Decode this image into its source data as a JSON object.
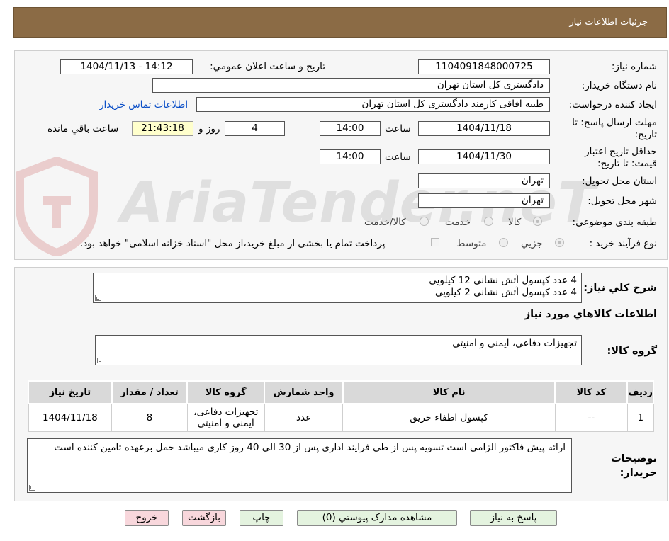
{
  "header": {
    "title": "جزئیات اطلاعات نیاز"
  },
  "need_number": {
    "label": "شماره نیاز:",
    "value": "1104091848000725"
  },
  "announce_datetime": {
    "label": "تاریخ و ساعت اعلان عمومي:",
    "value": "1404/11/13 - 14:12"
  },
  "buyer_org": {
    "label": "نام دستگاه خريدار:",
    "value": "دادگستری کل استان تهران"
  },
  "requester": {
    "label": "ايجاد کننده درخواست:",
    "value": "طیبه افاقی کارمند دادگستری کل استان تهران",
    "contact_link": "اطلاعات تماس خريدار"
  },
  "reply_deadline": {
    "label": "مهلت ارسال پاسخ: تا تاریخ:",
    "date": "1404/11/18",
    "time_label": "ساعت",
    "time": "14:00",
    "days": "4",
    "days_label": "روز و",
    "remaining": "21:43:18",
    "remaining_label": "ساعت باقي مانده"
  },
  "price_validity": {
    "label": "حداقل تاريخ اعتبار قيمت: تا تاريخ:",
    "date": "1404/11/30",
    "time_label": "ساعت",
    "time": "14:00"
  },
  "delivery_province": {
    "label": "استان محل تحويل:",
    "value": "تهران"
  },
  "delivery_city": {
    "label": "شهر محل تحويل:",
    "value": "تهران"
  },
  "category": {
    "label": "طبقه بندی موضوعی:",
    "options": [
      "کالا",
      "خدمت",
      "کالا/خدمت"
    ]
  },
  "purchase_process": {
    "label": "نوع فرآيند خريد :",
    "options": [
      "جزيي",
      "متوسط"
    ],
    "payment_note": "پرداخت تمام يا بخشی از مبلغ خريد،از محل \"اسناد خزانه اسلامی\" خواهد بود."
  },
  "general_description": {
    "label": "شرح کلي نياز:",
    "lines": [
      "4 عدد کپسول آتش نشانی 12 کیلویی",
      "4 عدد کپسول آتش نشانی 2 کیلویی"
    ]
  },
  "items_section": {
    "title": "اطلاعات کالاهاي مورد نياز"
  },
  "goods_group": {
    "label": "گروه کالا:",
    "value": "تجهیزات دفاعی، ایمنی و امنیتی"
  },
  "items_table": {
    "headers": [
      "رديف",
      "کد کالا",
      "نام کالا",
      "واحد شمارش",
      "گروه کالا",
      "تعداد / مقدار",
      "تاریخ نیاز"
    ],
    "rows": [
      [
        "1",
        "--",
        "کپسول اطفاء حریق",
        "عدد",
        "تجهیزات دفاعی، ایمنی و امنیتی",
        "8",
        "1404/11/18"
      ]
    ]
  },
  "buyer_notes": {
    "label": "توضيحات خريدار:",
    "value": "ارائه پیش فاکتور الزامی است تسویه پس از طی فرایند اداری پس از 30 الی 40 روز کاری میباشد حمل برعهده تامین کننده است"
  },
  "buttons": {
    "reply": "پاسخ به نياز",
    "attachments": "مشاهده مدارک پيوستي (0)",
    "print": "چاپ",
    "back": "بازگشت",
    "exit": "خروج"
  },
  "watermark": {
    "text": "AriaTender.neT"
  },
  "colors": {
    "header_bg": "#8b6b45",
    "link": "#0b4fc7",
    "remaining_bg": "#ffffcc",
    "button_green": "#e4f3df",
    "button_pink": "#f8d7dc"
  }
}
